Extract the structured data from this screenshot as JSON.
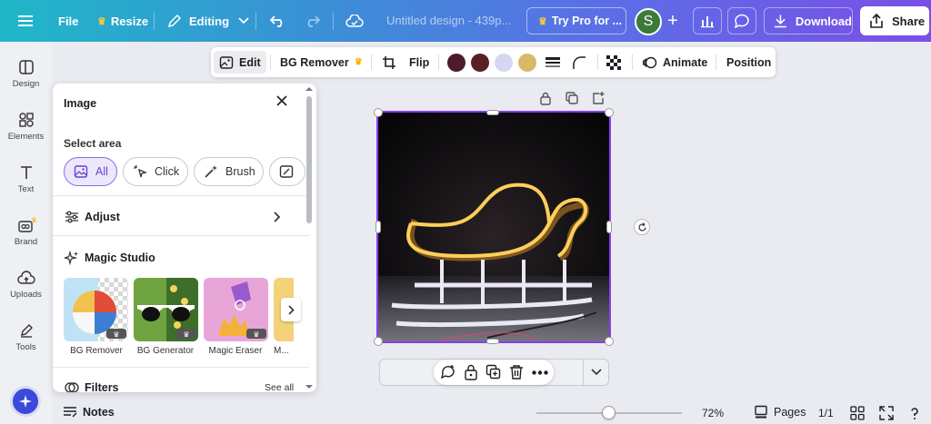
{
  "topbar": {
    "file": "File",
    "resize": "Resize",
    "editing": "Editing",
    "doc_title": "Untitled design - 439p...",
    "try_pro": "Try Pro for ...",
    "avatar_initial": "S",
    "download": "Download",
    "share": "Share"
  },
  "sidebar": {
    "items": [
      {
        "label": "Design",
        "icon": "layout-icon"
      },
      {
        "label": "Elements",
        "icon": "shapes-icon"
      },
      {
        "label": "Text",
        "icon": "text-icon"
      },
      {
        "label": "Brand",
        "icon": "brand-icon"
      },
      {
        "label": "Uploads",
        "icon": "upload-icon"
      },
      {
        "label": "Tools",
        "icon": "pen-icon"
      }
    ]
  },
  "panel": {
    "title": "Image",
    "select_area_label": "Select area",
    "select_options": [
      "All",
      "Click",
      "Brush"
    ],
    "adjust": "Adjust",
    "magic_studio": "Magic Studio",
    "tools": [
      "BG Remover",
      "BG Generator",
      "Magic Eraser",
      "M..."
    ],
    "filters": "Filters",
    "see_all": "See all"
  },
  "context_toolbar": {
    "edit": "Edit",
    "bg_remover": "BG Remover",
    "flip": "Flip",
    "colors": [
      "#4a1c2e",
      "#5a1f26",
      "#d7d6f2",
      "#d9b86a"
    ],
    "animate": "Animate",
    "position": "Position"
  },
  "bottombar": {
    "notes": "Notes",
    "zoom": "72%",
    "pages": "Pages",
    "page_count": "1/1"
  },
  "colors": {
    "accent": "#8b3df2",
    "primary_purple": "#6a3fd8"
  }
}
